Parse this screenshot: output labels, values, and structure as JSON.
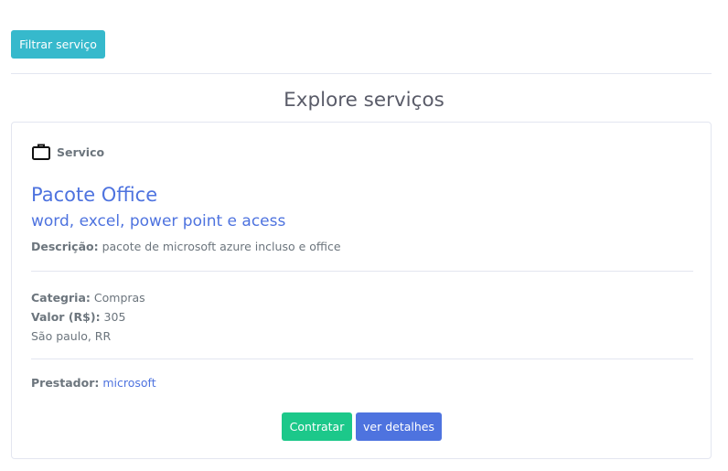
{
  "toolbar": {
    "filter_label": "Filtrar serviço"
  },
  "page": {
    "title": "Explore serviços"
  },
  "card": {
    "category_tag": "Servico",
    "title": "Pacote Office",
    "subtitle": "word, excel, power point e acess",
    "description_label": "Descrição:",
    "description_value": "pacote de microsoft azure incluso e office",
    "category_label": "Categria:",
    "category_value": "Compras",
    "price_label": "Valor (R$):",
    "price_value": "305",
    "location": "São paulo, RR",
    "provider_label": "Prestador:",
    "provider_value": "microsoft",
    "hire_label": "Contratar",
    "details_label": "ver detalhes"
  },
  "icons": {
    "category": "briefcase-icon"
  },
  "colors": {
    "info": "#36b9cc",
    "primary": "#4e73df",
    "success": "#1cc88a"
  }
}
